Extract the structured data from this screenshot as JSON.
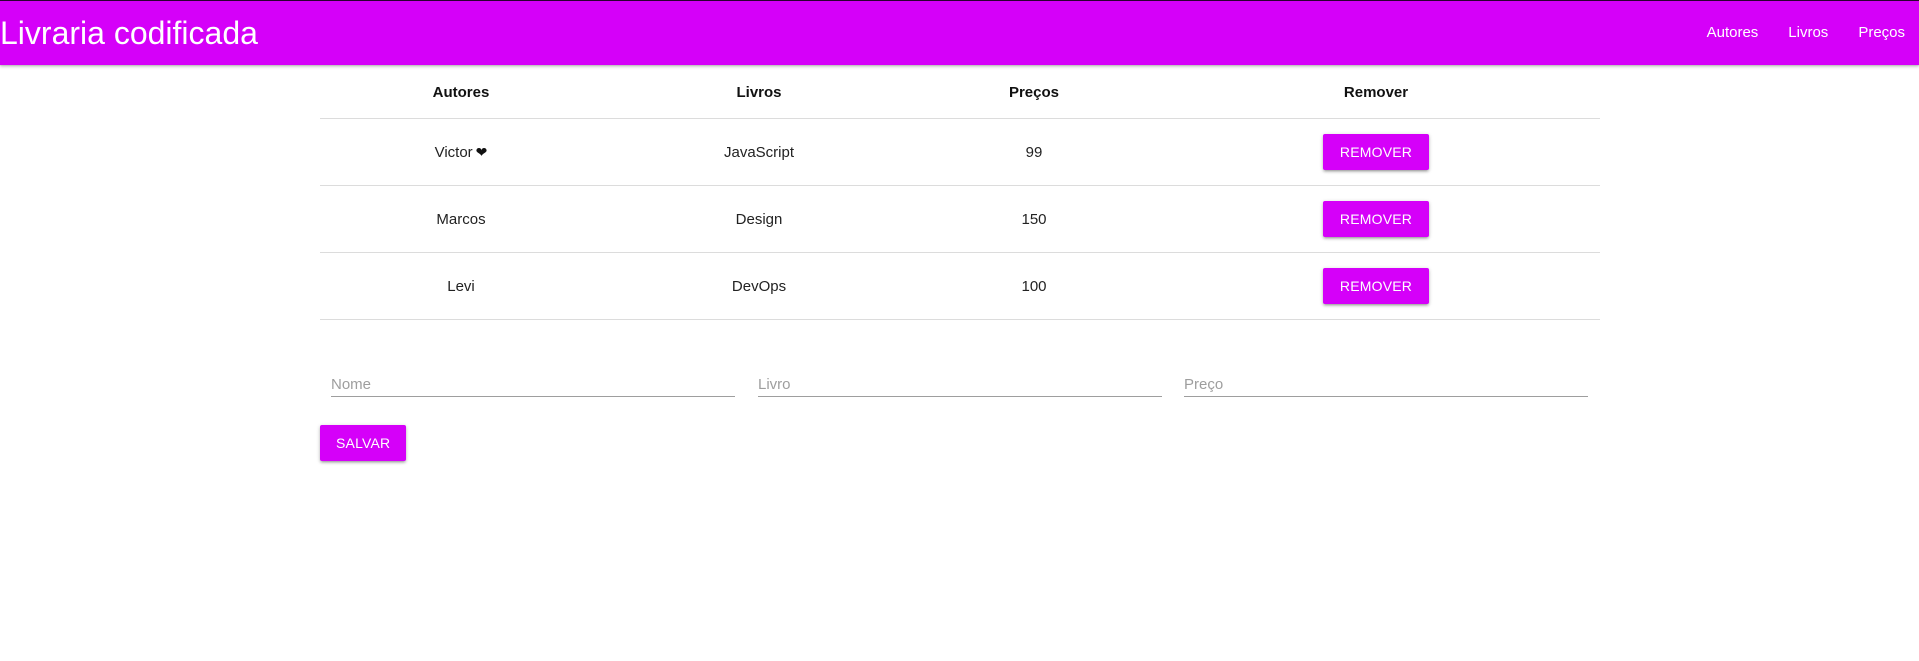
{
  "navbar": {
    "brand": "Livraria codificada",
    "links": [
      "Autores",
      "Livros",
      "Preços"
    ]
  },
  "table": {
    "headers": [
      "Autores",
      "Livros",
      "Preços",
      "Remover"
    ],
    "rows": [
      {
        "author": "Victor",
        "book": "JavaScript",
        "price": "99",
        "remove_label": "REMOVER",
        "author_icon": "heart-icon"
      },
      {
        "author": "Marcos",
        "book": "Design",
        "price": "150",
        "remove_label": "REMOVER"
      },
      {
        "author": "Levi",
        "book": "DevOps",
        "price": "100",
        "remove_label": "REMOVER"
      }
    ]
  },
  "form": {
    "name_placeholder": "Nome",
    "book_placeholder": "Livro",
    "price_placeholder": "Preço",
    "save_label": "SALVAR"
  },
  "colors": {
    "accent": "#d500f9",
    "text": "#222222",
    "divider": "#dcdcdc"
  }
}
